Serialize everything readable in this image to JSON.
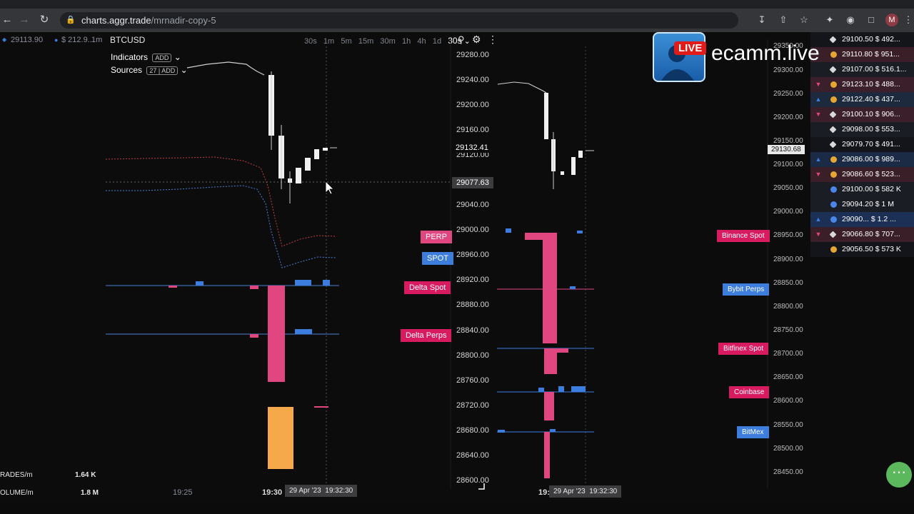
{
  "browser": {
    "url_host": "charts.aggr.trade",
    "url_path": "/mrnadir-copy-5",
    "avatar_initial": "M"
  },
  "header": {
    "ticker_price": "29113.90",
    "ticker_vol": "$ 212.9...",
    "ticker_tf": "1m",
    "symbol": "BTCUSD",
    "timeframes": [
      "30s",
      "1m",
      "5m",
      "15m",
      "30m",
      "1h",
      "4h",
      "1d"
    ],
    "active_tf": "30s",
    "indicators_label": "Indicators",
    "indicators_btn": "ADD",
    "sources_label": "Sources",
    "sources_btn": "27 | ADD"
  },
  "left_axis": {
    "ticks": [
      "29280.00",
      "29240.00",
      "29200.00",
      "29160.00",
      "29120.00",
      "29040.00",
      "29000.00",
      "28960.00",
      "28920.00",
      "28880.00",
      "28840.00",
      "28800.00",
      "28760.00",
      "28720.00",
      "28680.00",
      "28640.00",
      "28600.00"
    ],
    "last_price": "29132.41",
    "cursor_price": "29077.63"
  },
  "right_axis": {
    "ticks": [
      "29350.00",
      "29300.00",
      "29250.00",
      "29200.00",
      "29150.00",
      "29100.00",
      "29050.00",
      "29000.00",
      "28950.00",
      "28900.00",
      "28850.00",
      "28800.00",
      "28750.00",
      "28700.00",
      "28650.00",
      "28600.00",
      "28550.00",
      "28500.00",
      "28450.00"
    ],
    "last_price": "29130.68"
  },
  "left_tags": {
    "perp": "PERP",
    "spot": "SPOT",
    "delta_spot": "Delta Spot",
    "delta_perps": "Delta Perps"
  },
  "right_tags": {
    "binance_spot": "Binance Spot",
    "bybit_perps": "Bybit Perps",
    "bitfinex_spot": "Bitfinex Spot",
    "coinbase": "Coinbase",
    "bitmex": "BitMex"
  },
  "stats": {
    "trades_label": "RADES/m",
    "trades_value": "1.64 K",
    "volume_label": "OLUME/m",
    "volume_value": "1.8 M"
  },
  "time_axis": {
    "t1": "19:25",
    "t2": "19:30",
    "cursor_time": "29 Apr '23  19:32:30",
    "r_t1": "19:3",
    "r_cursor_time": "29 Apr '23  19:32:30"
  },
  "feed": [
    {
      "dir": "",
      "icon": "diamond",
      "price": "29100.50",
      "amt": "$ 492..."
    },
    {
      "dir": "",
      "icon": "gold",
      "price": "29110.80",
      "amt": "$ 951..."
    },
    {
      "dir": "",
      "icon": "diamond",
      "price": "29107.00",
      "amt": "$ 516.1..."
    },
    {
      "dir": "down",
      "icon": "gold",
      "price": "29123.10",
      "amt": "$ 488..."
    },
    {
      "dir": "up",
      "icon": "gold",
      "price": "29122.40",
      "amt": "$ 437..."
    },
    {
      "dir": "down",
      "icon": "diamond",
      "price": "29100.10",
      "amt": "$ 906..."
    },
    {
      "dir": "",
      "icon": "diamond",
      "price": "29098.00",
      "amt": "$ 553..."
    },
    {
      "dir": "",
      "icon": "diamond",
      "price": "29079.70",
      "amt": "$ 491..."
    },
    {
      "dir": "up",
      "icon": "gold",
      "price": "29086.00",
      "amt": "$ 989..."
    },
    {
      "dir": "down",
      "icon": "gold",
      "price": "29086.60",
      "amt": "$ 523..."
    },
    {
      "dir": "",
      "icon": "blue",
      "price": "29100.00",
      "amt": "$ 582 K"
    },
    {
      "dir": "",
      "icon": "blue",
      "price": "29094.20",
      "amt": "$ 1 M"
    },
    {
      "dir": "up",
      "icon": "blue",
      "price": "29090...",
      "amt": "$ 1.2 ..."
    },
    {
      "dir": "down",
      "icon": "diamond",
      "price": "29066.80",
      "amt": "$ 707..."
    },
    {
      "dir": "",
      "icon": "gold",
      "price": "29056.50",
      "amt": "$ 573 K"
    }
  ],
  "overlay": {
    "live_badge": "LIVE",
    "brand": "ecamm.live"
  },
  "colors": {
    "buy": "#3c7ee0",
    "sell": "#e0467f",
    "volume": "#f5a94a",
    "tag_pink": "#d81b60",
    "tag_blue": "#3d7ddb"
  }
}
